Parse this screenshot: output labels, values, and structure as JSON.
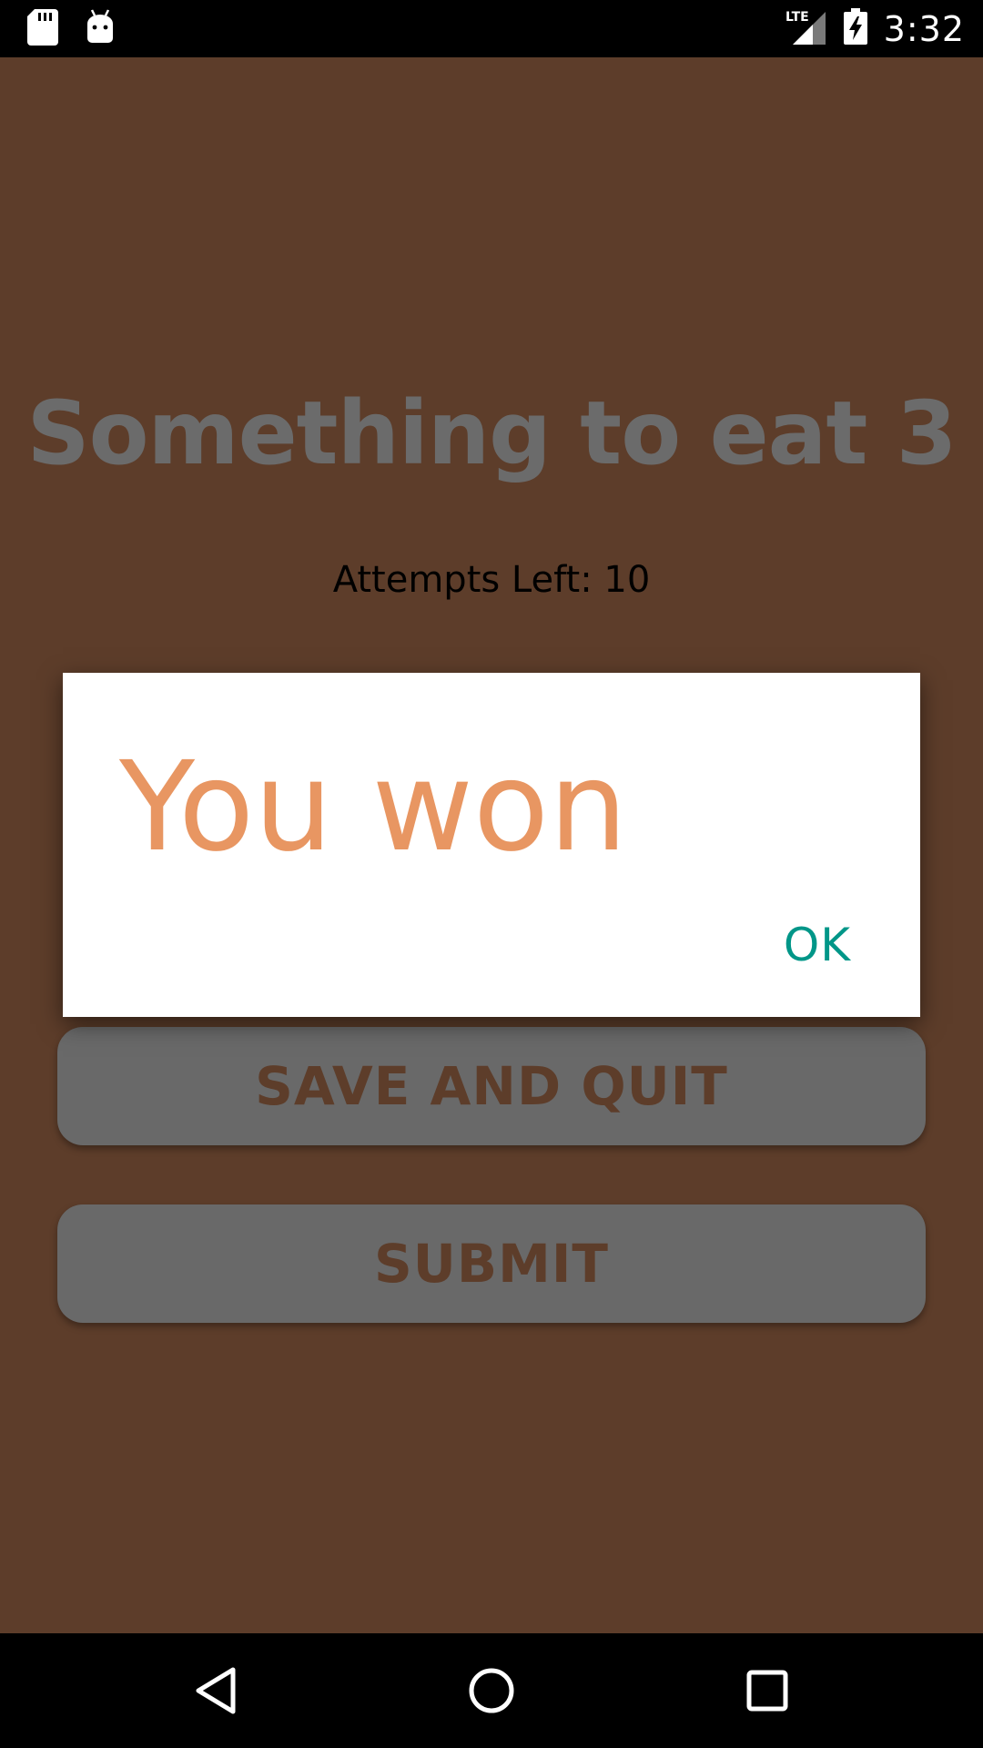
{
  "status_bar": {
    "time": "3:32",
    "left_icons": [
      "sd-card-icon",
      "android-debug-icon"
    ],
    "right_icons": [
      "lte-signal-icon",
      "battery-charging-icon"
    ]
  },
  "game": {
    "title": "Something to eat 3",
    "attempts_text": "Attempts Left: 10"
  },
  "buttons": {
    "save_and_quit": "SAVE AND QUIT",
    "submit": "SUBMIT"
  },
  "dialog": {
    "message": "You won",
    "ok_label": "OK"
  },
  "colors": {
    "background": "#5d3d2a",
    "title": "#6b6b6b",
    "button_bg": "#696969",
    "button_text": "#5d3d2a",
    "dialog_message": "#e89662",
    "dialog_ok": "#009688"
  },
  "nav_bar": {
    "icons": [
      "back-icon",
      "home-icon",
      "recents-icon"
    ]
  }
}
